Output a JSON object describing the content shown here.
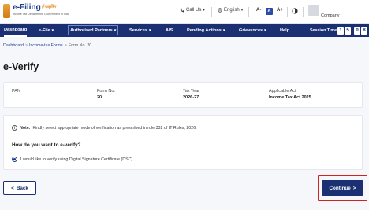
{
  "header": {
    "brand": "e-Filing",
    "brand_hindi": "ई-फाइलिंग",
    "tagline": "Income Tax Department, Government of India",
    "call_us": "Call Us",
    "language": "English",
    "a11y_decrease": "A-",
    "a11y_default": "A",
    "a11y_increase": "A+",
    "user_label": "Company",
    "icons": {
      "phone": "phone-icon",
      "globe": "globe-icon",
      "contrast": "contrast-icon",
      "chevron": "chevron-down-icon"
    }
  },
  "nav": {
    "items": [
      {
        "label": "Dashboard",
        "active": true,
        "dropdown": false
      },
      {
        "label": "e-File",
        "active": false,
        "dropdown": true
      },
      {
        "label": "Authorised Partners",
        "active": false,
        "dropdown": true
      },
      {
        "label": "Services",
        "active": false,
        "dropdown": true
      },
      {
        "label": "AIS",
        "active": false,
        "dropdown": false
      },
      {
        "label": "Pending Actions",
        "active": false,
        "dropdown": true
      },
      {
        "label": "Grievances",
        "active": false,
        "dropdown": true
      },
      {
        "label": "Help",
        "active": false,
        "dropdown": false
      }
    ],
    "session_label": "Session Time",
    "session_digits": [
      "1",
      "5",
      "0",
      "8"
    ]
  },
  "breadcrumb": {
    "items": [
      "Dashboard",
      "Income-tax Forms",
      "Form No. 20"
    ],
    "separator": ">"
  },
  "page_title": "e-Verify",
  "info": {
    "pan_label": "PAN",
    "pan_value": "",
    "form_label": "Form No.",
    "form_value": "20",
    "tax_year_label": "Tax Year",
    "tax_year_value": "2026-27",
    "act_label": "Applicable Act",
    "act_value": "Income Tax Act 2025"
  },
  "verify": {
    "note_label": "Note:",
    "note_text": "Kindly select appropriate mode of verification as prescribed in rule 332 of IT Rules, 2026.",
    "question": "How do you want to e-verify?",
    "option_label": "I would like to verify using Digital Signature Certificate (DSC)",
    "option_selected": true
  },
  "actions": {
    "back_label": "Back",
    "continue_label": "Continue",
    "back_glyph": "<",
    "continue_glyph": ">"
  },
  "colors": {
    "primary": "#1b2f73",
    "link": "#1b3f8e",
    "highlight": "#d32020",
    "accent": "#e08a1e"
  }
}
